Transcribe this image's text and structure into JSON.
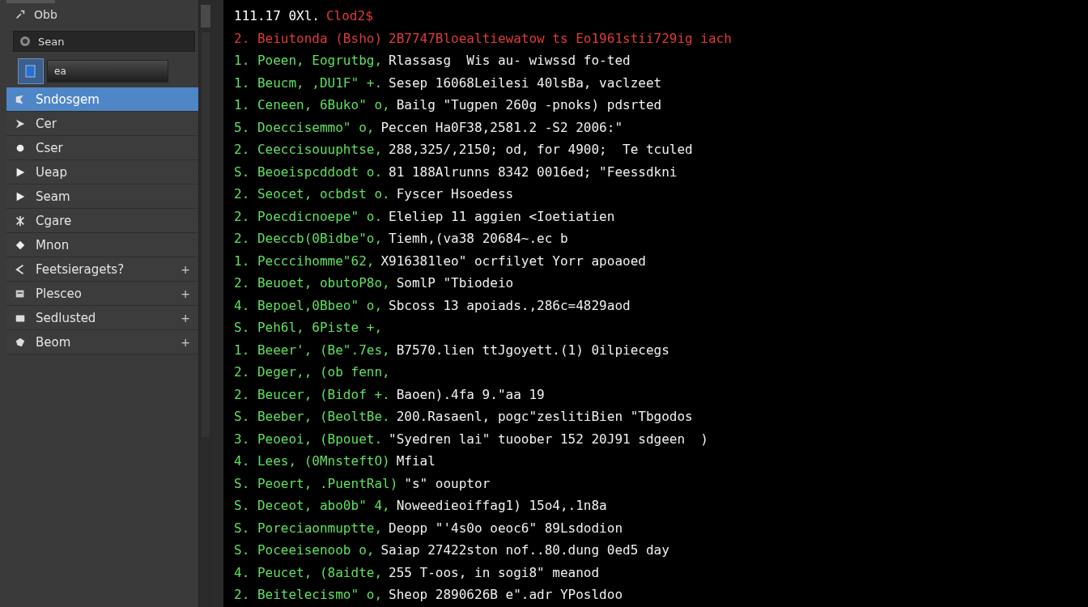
{
  "sidebar": {
    "header": "Obb",
    "search": {
      "value": "Sean"
    },
    "field": {
      "value": "ea"
    },
    "items": [
      {
        "label": "Sndosgem",
        "selected": true,
        "kind": "plain"
      },
      {
        "label": "Cer",
        "selected": false,
        "kind": "plain"
      },
      {
        "label": "Cser",
        "selected": false,
        "kind": "plain"
      },
      {
        "label": "Ueap",
        "selected": false,
        "kind": "plain"
      },
      {
        "label": "Seam",
        "selected": false,
        "kind": "plain"
      },
      {
        "label": "Cgare",
        "selected": false,
        "kind": "plain"
      },
      {
        "label": "Mnon",
        "selected": false,
        "kind": "plain"
      },
      {
        "label": "Feetsieragets?",
        "selected": false,
        "kind": "expandable",
        "toggle": "+"
      },
      {
        "label": "Plesceo",
        "selected": false,
        "kind": "expandable",
        "toggle": "+"
      },
      {
        "label": "Sedlusted",
        "selected": false,
        "kind": "expandable",
        "toggle": "+"
      },
      {
        "label": "Beom",
        "selected": false,
        "kind": "expandable",
        "toggle": "+"
      }
    ]
  },
  "terminal": {
    "lines": [
      {
        "kind": "header",
        "prefix": "111.17 0Xl.",
        "text": "Clod2$"
      },
      {
        "kind": "error",
        "prefix": "2. Beiutonda (Bsho)",
        "text": "2B7747Bloealtiewatow ts Eo1961stii729ig iach"
      },
      {
        "kind": "log",
        "prefix": "1. Poeen, Eogrutbg,",
        "text": "Rlassasg  Wis au- wiwssd fo-ted"
      },
      {
        "kind": "log",
        "prefix": "1. Beucm, ,DU1F\" +.",
        "text": "Sesep 16068Leilesi 40lsBa, vaclzeet"
      },
      {
        "kind": "log",
        "prefix": "1. Ceneen, 6Buko\" o,",
        "text": "Bailg \"Tugpen 260g -pnoks) pdsrted"
      },
      {
        "kind": "log",
        "prefix": "5. Doeccisemmo\" o,",
        "text": "Peccen Ha0F38,2581.2 -S2 2006:\""
      },
      {
        "kind": "log",
        "prefix": "2. Ceeccisouuphtse,",
        "text": "288,325/,2150; od, for 4900;  Te tculed"
      },
      {
        "kind": "log",
        "prefix": "S. Beoeispcddodt o.",
        "text": "81 188Alrunns 8342 0016ed; \"Feessdkni"
      },
      {
        "kind": "log",
        "prefix": "2. Seocet, ocbdst o.",
        "text": "Fyscer Hsoedess"
      },
      {
        "kind": "log",
        "prefix": "2. Poecdicnoepe\" o.",
        "text": "Eleliep 11 aggien <Ioetiatien"
      },
      {
        "kind": "log",
        "prefix": "2. Deeccb(0Bidbe\"o,",
        "text": "Tiemh,(va38 20684~.ec b"
      },
      {
        "kind": "log",
        "prefix": "1. Pecccihomme\"62,",
        "text": "X916381leo\" ocrfilyet Yorr apoaoed"
      },
      {
        "kind": "log",
        "prefix": "2. Beuoet, obutoP8o,",
        "text": "SomlP \"Tbiodeio"
      },
      {
        "kind": "log",
        "prefix": "4. Bepoel,0Bbeo\" o,",
        "text": "Sbcoss 13 apoiads.,286c=4829aod"
      },
      {
        "kind": "log",
        "prefix": "S. Peh6l, 6Piste +,"
      },
      {
        "kind": "log",
        "prefix": "1. Beeer', (Be\".7es,",
        "text": "B7570.lien ttJgoyett.(1) 0ilpiecegs"
      },
      {
        "kind": "log",
        "prefix": "2. Deger,, (ob fenn,"
      },
      {
        "kind": "log",
        "prefix": "2. Beucer, (Bidof +.",
        "text": "Baoen).4fa 9.\"aa 19"
      },
      {
        "kind": "log",
        "prefix": "S. Beeber, (BeoltBe.",
        "text": "200.Rasaenl, pogc\"zeslitiBien \"Tbgodos"
      },
      {
        "kind": "log",
        "prefix": "3. Peoeoi, (Bpouet.",
        "text": "\"Syedren lai\" tuoober 152 20J91 sdgeen  )"
      },
      {
        "kind": "log",
        "prefix": "4. Lees, (0MnsteftO)",
        "text": "Mfial"
      },
      {
        "kind": "log",
        "prefix": "S. Peoert, .PuentRal)",
        "text": "\"s\" oouptor"
      },
      {
        "kind": "log",
        "prefix": "S. Deceot, abo0b\" 4,",
        "text": "Noweedieoiffag1) 15o4,.1n8a"
      },
      {
        "kind": "log",
        "prefix": "S. Poreciaonmuptte,",
        "text": "Deopp \"'4s0o oeoc6\" 89Lsdodion"
      },
      {
        "kind": "log",
        "prefix": "S. Poceeisenoob o,",
        "text": "Saiap 27422ston nof..80.dung 0ed5 day"
      },
      {
        "kind": "log",
        "prefix": "4. Peucet, (8aidte,",
        "text": "255 T-oos, in sogi8\" meanod"
      },
      {
        "kind": "log",
        "prefix": "2. Beitelecismo\" o,",
        "text": "Sheop 2890626B e\".adr YPosldoo"
      }
    ]
  }
}
